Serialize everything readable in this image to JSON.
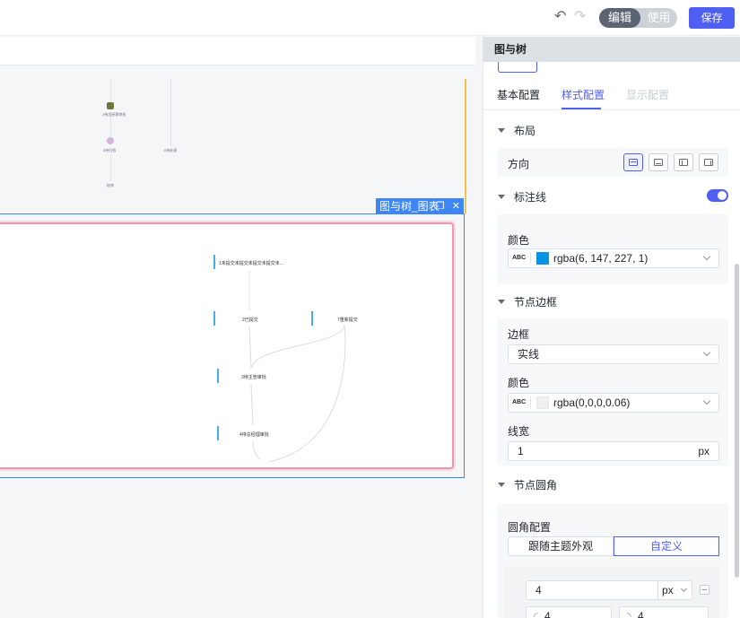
{
  "toolbar": {
    "mode_edit": "编辑",
    "mode_use": "使用",
    "save_label": "保存",
    "undo_icon": "undo-icon",
    "redo_icon": "redo-icon"
  },
  "canvas": {
    "selected_widget_label": "图与树_图表",
    "tree_nodes": [
      "1未提交未提交未提交未提交未...",
      "2已提交",
      "7重新提交",
      "3待主管审批",
      "4待总经理审批"
    ]
  },
  "panel": {
    "title": "图与树",
    "tabs": [
      "基本配置",
      "样式配置",
      "显示配置"
    ],
    "active_tab": "样式配置",
    "layout": {
      "section": "布局",
      "direction_label": "方向"
    },
    "annotation": {
      "section": "标注线",
      "enabled": true,
      "color_label": "颜色",
      "color_prefix": "ABC",
      "color_value": "rgba(6, 147, 227, 1)",
      "color_hex": "#0693e3"
    },
    "node_border": {
      "section": "节点边框",
      "border_label": "边框",
      "border_value": "实线",
      "color_label": "颜色",
      "color_prefix": "ABC",
      "color_value": "rgba(0,0,0,0.06)",
      "width_label": "线宽",
      "width_value": "1",
      "width_unit": "px"
    },
    "node_radius": {
      "section": "节点圆角",
      "config_label": "圆角配置",
      "options": [
        "跟随主题外观",
        "自定义"
      ],
      "selected": "自定义",
      "radius_value": "4",
      "radius_unit": "px",
      "corner_values": [
        "4",
        "4"
      ]
    }
  }
}
